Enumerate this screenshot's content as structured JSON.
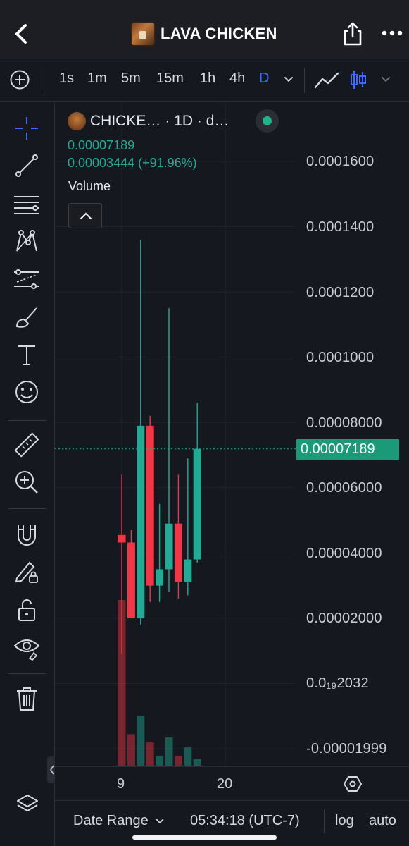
{
  "header": {
    "title": "LAVA CHICKEN",
    "back_icon": "chevron-left-icon",
    "share_icon": "share-icon",
    "more_icon": "more-horizontal-icon"
  },
  "timeframes": {
    "items": [
      "1s",
      "1m",
      "5m",
      "15m",
      "1h",
      "4h",
      "D"
    ],
    "active": "D",
    "active_color": "#3b6cff"
  },
  "legend": {
    "symbol": "CHICKE…",
    "interval": "· 1D · d…",
    "price": "0.00007189",
    "change": "0.00003444 (+91.96%)",
    "volume_label": "Volume"
  },
  "price_axis": {
    "labels": [
      "0.0001600",
      "0.0001400",
      "0.0001200",
      "0.0001000",
      "0.00008000",
      "0.00006000",
      "0.00004000",
      "0.00002000",
      "0.0₁₉2032",
      "-0.00001999"
    ],
    "current_price_tag": "0.00007189",
    "up_color": "#22ab94",
    "down_color": "#f23645"
  },
  "time_axis": {
    "labels": [
      "9",
      "20"
    ]
  },
  "footer": {
    "date_range": "Date Range",
    "time": "05:34:18 (UTC-7)",
    "log": "log",
    "auto": "auto"
  },
  "chart_data": {
    "type": "candlestick",
    "x": [
      1,
      2,
      3,
      4,
      5,
      6,
      7,
      8,
      9
    ],
    "open": [
      4.55e-05,
      4.32e-05,
      2e-05,
      7.9e-05,
      3e-05,
      3.5e-05,
      4.9e-05,
      3.1e-05,
      3.8e-05
    ],
    "high": [
      6.4e-05,
      4.7e-05,
      0.000136,
      8.2e-05,
      5.5e-05,
      0.000115,
      6.4e-05,
      6.9e-05,
      8.6e-05
    ],
    "low": [
      9e-06,
      2e-05,
      1.8e-05,
      2.5e-05,
      2.5e-05,
      2.8e-05,
      2.6e-05,
      2.7e-05,
      3.7e-05
    ],
    "close": [
      4.32e-05,
      2e-05,
      7.9e-05,
      3e-05,
      3.5e-05,
      4.9e-05,
      3.1e-05,
      3.8e-05,
      7.19e-05
    ],
    "volume_relative": [
      1.0,
      0.19,
      0.3,
      0.14,
      0.06,
      0.17,
      0.06,
      0.11,
      0.04
    ],
    "ylim": [
      -2e-05,
      0.00016
    ],
    "last_price": 7.189e-05
  }
}
